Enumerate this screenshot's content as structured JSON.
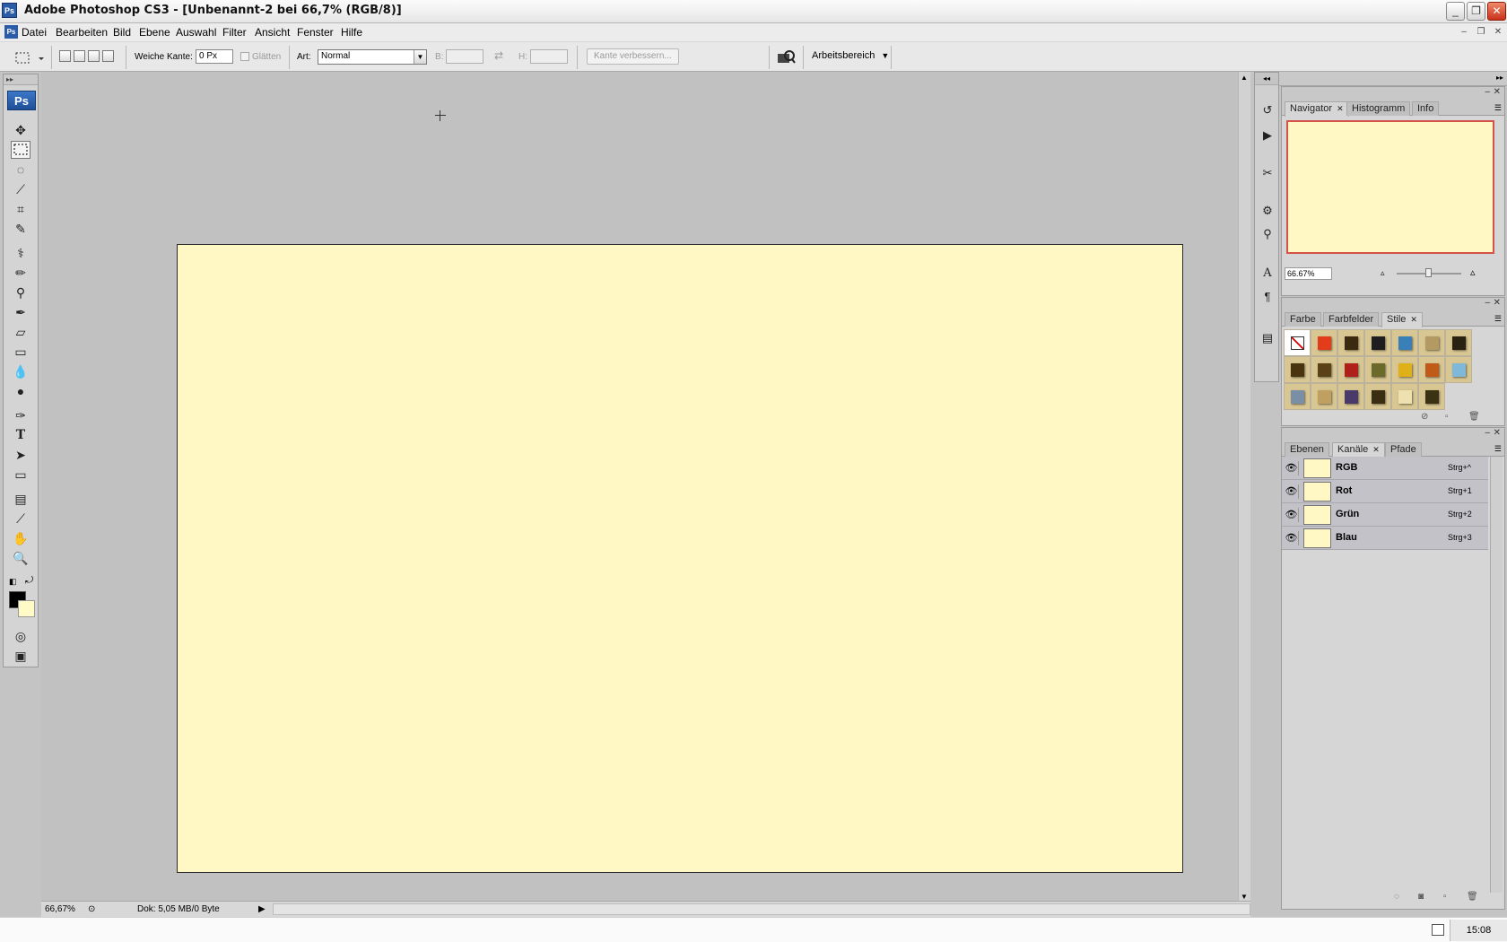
{
  "window": {
    "title": "Adobe Photoshop CS3 - [Unbenannt-2 bei 66,7% (RGB/8)]",
    "app_icon": "Ps",
    "minimize_icon": "minimize-icon",
    "maximize_icon": "restore-icon",
    "close_icon": "close-icon"
  },
  "menu": {
    "items": [
      "Datei",
      "Bearbeiten",
      "Bild",
      "Ebene",
      "Auswahl",
      "Filter",
      "Ansicht",
      "Fenster",
      "Hilfe"
    ]
  },
  "options": {
    "feather_label": "Weiche Kante:",
    "feather_value": "0 Px",
    "antialias_label": "Glätten",
    "style_label": "Art:",
    "style_value": "Normal",
    "width_label": "B:",
    "height_label": "H:",
    "refine_label": "Kante verbessern...",
    "workspace_label": "Arbeitsbereich"
  },
  "toolbox": {
    "logo": "Ps",
    "tools": [
      "move-tool-icon",
      "marquee-tool-icon",
      "lasso-tool-icon",
      "magic-wand-icon",
      "crop-tool-icon",
      "slice-tool-icon",
      "healing-brush-icon",
      "brush-tool-icon",
      "clone-stamp-icon",
      "history-brush-icon",
      "eraser-tool-icon",
      "gradient-tool-icon",
      "blur-tool-icon",
      "dodge-tool-icon",
      "pen-tool-icon",
      "type-tool-icon",
      "path-selection-icon",
      "shape-tool-icon",
      "notes-tool-icon",
      "eyedropper-icon",
      "hand-tool-icon",
      "zoom-tool-icon"
    ],
    "foreground_color": "#000000",
    "background_color": "#fffac6"
  },
  "document": {
    "canvas_color": "#fff8c5"
  },
  "status": {
    "zoom": "66,67%",
    "doc_info": "Dok: 5,05 MB/0 Byte"
  },
  "taskbar": {
    "clock": "15:08"
  },
  "navigator_panel": {
    "tabs": [
      "Navigator",
      "Histogramm",
      "Info"
    ],
    "active_tab": "Navigator",
    "zoom": "66.67%",
    "frame_color": "#d5524a"
  },
  "styles_panel": {
    "tabs": [
      "Farbe",
      "Farbfelder",
      "Stile"
    ],
    "active_tab": "Stile",
    "swatch_count": 20
  },
  "channels_panel": {
    "tabs": [
      "Ebenen",
      "Kanäle",
      "Pfade"
    ],
    "active_tab": "Kanäle",
    "channels": [
      {
        "name": "RGB",
        "shortcut": "Strg+^"
      },
      {
        "name": "Rot",
        "shortcut": "Strg+1"
      },
      {
        "name": "Grün",
        "shortcut": "Strg+2"
      },
      {
        "name": "Blau",
        "shortcut": "Strg+3"
      }
    ]
  }
}
